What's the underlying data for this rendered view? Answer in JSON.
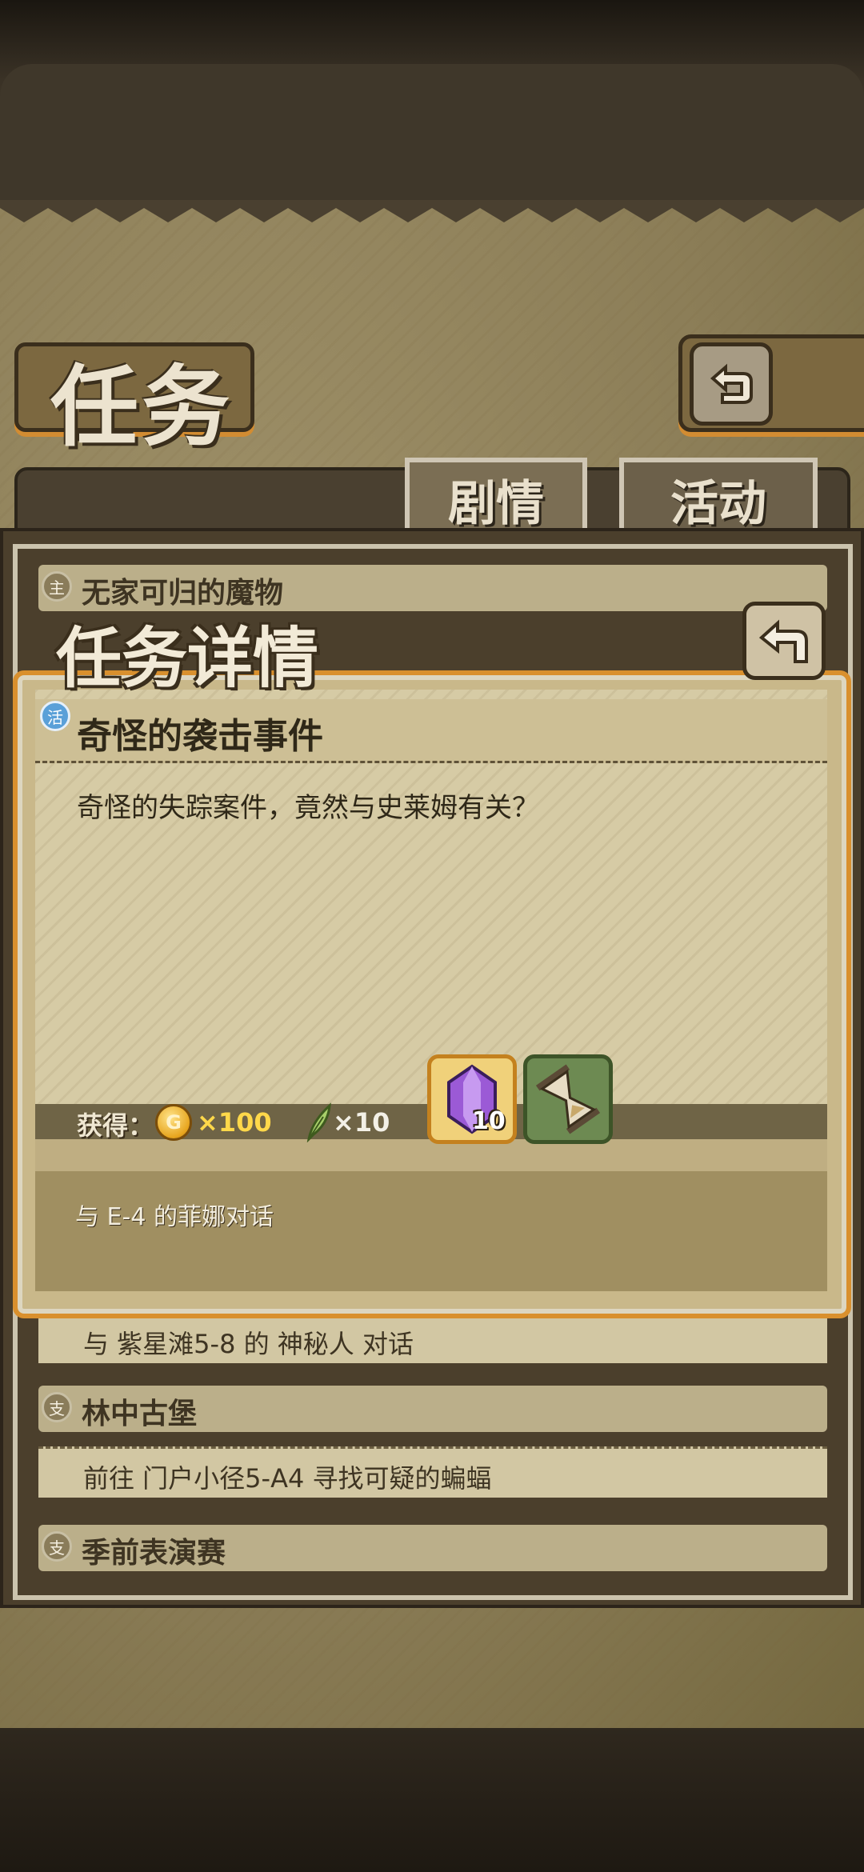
{
  "header": {
    "title": "任务",
    "back_icon": "return-arrow-icon"
  },
  "tabs": [
    {
      "label": "剧情",
      "active": true
    },
    {
      "label": "活动",
      "active": false
    }
  ],
  "quest_list": {
    "items": [
      {
        "badge": "主",
        "title": "无家可归的魔物"
      },
      {
        "subtitle": "与 紫星滩5-8 的 神秘人 对话"
      },
      {
        "badge": "支",
        "title": "林中古堡",
        "subtitle": "前往 门户小径5-A4 寻找可疑的蝙蝠"
      },
      {
        "badge": "支",
        "title": "季前表演赛"
      }
    ]
  },
  "detail": {
    "title": "任务详情",
    "close_icon": "return-arrow-icon",
    "tag": "活",
    "quest_name": "奇怪的袭击事件",
    "description": "奇怪的失踪案件，竟然与史莱姆有关？",
    "reward_label": "获得：",
    "coin_icon": "G",
    "coin_amount": "×100",
    "feather_amount": "×10",
    "item_gem_count": "10",
    "objective": "与 E-4 的菲娜对话"
  },
  "colors": {
    "accent_orange": "#d9902e",
    "parchment": "#d6cba5",
    "gold_text": "#ffd84a"
  }
}
